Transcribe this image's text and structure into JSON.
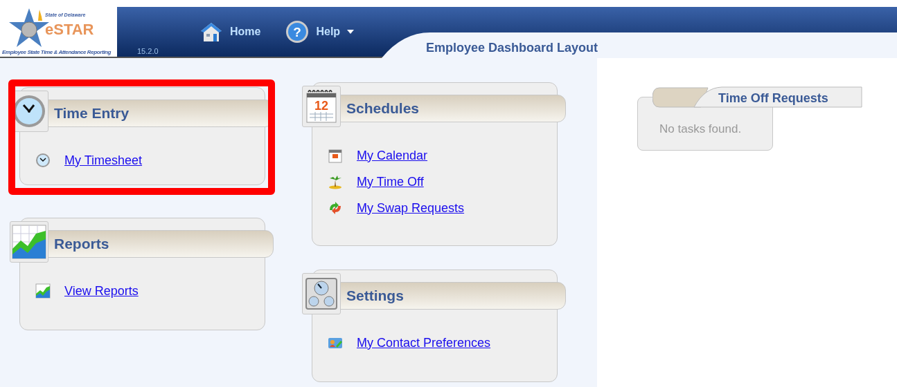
{
  "logo": {
    "state": "State of Delaware",
    "name": "eSTAR",
    "tagline": "Employee State Time & Attendance Reporting"
  },
  "version": "15.2.0",
  "nav": [
    {
      "label": "Home",
      "kind": "home",
      "has_menu": false
    },
    {
      "label": "Help",
      "kind": "help",
      "has_menu": true,
      "icon_glyph": "?"
    }
  ],
  "page_title": "Employee Dashboard Layout",
  "columns": [
    [
      {
        "title": "Time Entry",
        "kind": "clock",
        "highlighted": true,
        "links": [
          {
            "label": "My Timesheet",
            "kind": "clock"
          }
        ]
      },
      {
        "title": "Reports",
        "kind": "chart",
        "highlighted": false,
        "links": [
          {
            "label": "View Reports",
            "kind": "chart"
          }
        ]
      }
    ],
    [
      {
        "title": "Schedules",
        "kind": "calendar",
        "icon_glyph": "12",
        "highlighted": false,
        "links": [
          {
            "label": "My Calendar",
            "kind": "calendar"
          },
          {
            "label": "My Time Off",
            "kind": "palm"
          },
          {
            "label": "My Swap Requests",
            "kind": "swap"
          }
        ]
      },
      {
        "title": "Settings",
        "kind": "gauges",
        "highlighted": false,
        "links": [
          {
            "label": "My Contact Preferences",
            "kind": "contact"
          }
        ]
      }
    ]
  ],
  "time_off_requests": {
    "title": "Time Off Requests",
    "message": "No tasks found."
  }
}
